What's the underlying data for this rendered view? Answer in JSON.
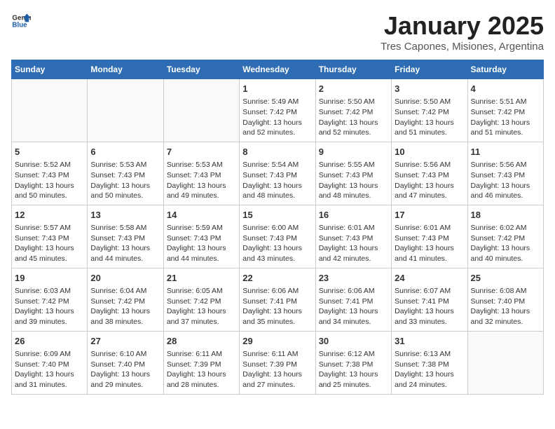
{
  "header": {
    "logo_general": "General",
    "logo_blue": "Blue",
    "title": "January 2025",
    "subtitle": "Tres Capones, Misiones, Argentina"
  },
  "weekdays": [
    "Sunday",
    "Monday",
    "Tuesday",
    "Wednesday",
    "Thursday",
    "Friday",
    "Saturday"
  ],
  "weeks": [
    [
      {
        "day": "",
        "info": ""
      },
      {
        "day": "",
        "info": ""
      },
      {
        "day": "",
        "info": ""
      },
      {
        "day": "1",
        "info": "Sunrise: 5:49 AM\nSunset: 7:42 PM\nDaylight: 13 hours\nand 52 minutes."
      },
      {
        "day": "2",
        "info": "Sunrise: 5:50 AM\nSunset: 7:42 PM\nDaylight: 13 hours\nand 52 minutes."
      },
      {
        "day": "3",
        "info": "Sunrise: 5:50 AM\nSunset: 7:42 PM\nDaylight: 13 hours\nand 51 minutes."
      },
      {
        "day": "4",
        "info": "Sunrise: 5:51 AM\nSunset: 7:42 PM\nDaylight: 13 hours\nand 51 minutes."
      }
    ],
    [
      {
        "day": "5",
        "info": "Sunrise: 5:52 AM\nSunset: 7:43 PM\nDaylight: 13 hours\nand 50 minutes."
      },
      {
        "day": "6",
        "info": "Sunrise: 5:53 AM\nSunset: 7:43 PM\nDaylight: 13 hours\nand 50 minutes."
      },
      {
        "day": "7",
        "info": "Sunrise: 5:53 AM\nSunset: 7:43 PM\nDaylight: 13 hours\nand 49 minutes."
      },
      {
        "day": "8",
        "info": "Sunrise: 5:54 AM\nSunset: 7:43 PM\nDaylight: 13 hours\nand 48 minutes."
      },
      {
        "day": "9",
        "info": "Sunrise: 5:55 AM\nSunset: 7:43 PM\nDaylight: 13 hours\nand 48 minutes."
      },
      {
        "day": "10",
        "info": "Sunrise: 5:56 AM\nSunset: 7:43 PM\nDaylight: 13 hours\nand 47 minutes."
      },
      {
        "day": "11",
        "info": "Sunrise: 5:56 AM\nSunset: 7:43 PM\nDaylight: 13 hours\nand 46 minutes."
      }
    ],
    [
      {
        "day": "12",
        "info": "Sunrise: 5:57 AM\nSunset: 7:43 PM\nDaylight: 13 hours\nand 45 minutes."
      },
      {
        "day": "13",
        "info": "Sunrise: 5:58 AM\nSunset: 7:43 PM\nDaylight: 13 hours\nand 44 minutes."
      },
      {
        "day": "14",
        "info": "Sunrise: 5:59 AM\nSunset: 7:43 PM\nDaylight: 13 hours\nand 44 minutes."
      },
      {
        "day": "15",
        "info": "Sunrise: 6:00 AM\nSunset: 7:43 PM\nDaylight: 13 hours\nand 43 minutes."
      },
      {
        "day": "16",
        "info": "Sunrise: 6:01 AM\nSunset: 7:43 PM\nDaylight: 13 hours\nand 42 minutes."
      },
      {
        "day": "17",
        "info": "Sunrise: 6:01 AM\nSunset: 7:43 PM\nDaylight: 13 hours\nand 41 minutes."
      },
      {
        "day": "18",
        "info": "Sunrise: 6:02 AM\nSunset: 7:42 PM\nDaylight: 13 hours\nand 40 minutes."
      }
    ],
    [
      {
        "day": "19",
        "info": "Sunrise: 6:03 AM\nSunset: 7:42 PM\nDaylight: 13 hours\nand 39 minutes."
      },
      {
        "day": "20",
        "info": "Sunrise: 6:04 AM\nSunset: 7:42 PM\nDaylight: 13 hours\nand 38 minutes."
      },
      {
        "day": "21",
        "info": "Sunrise: 6:05 AM\nSunset: 7:42 PM\nDaylight: 13 hours\nand 37 minutes."
      },
      {
        "day": "22",
        "info": "Sunrise: 6:06 AM\nSunset: 7:41 PM\nDaylight: 13 hours\nand 35 minutes."
      },
      {
        "day": "23",
        "info": "Sunrise: 6:06 AM\nSunset: 7:41 PM\nDaylight: 13 hours\nand 34 minutes."
      },
      {
        "day": "24",
        "info": "Sunrise: 6:07 AM\nSunset: 7:41 PM\nDaylight: 13 hours\nand 33 minutes."
      },
      {
        "day": "25",
        "info": "Sunrise: 6:08 AM\nSunset: 7:40 PM\nDaylight: 13 hours\nand 32 minutes."
      }
    ],
    [
      {
        "day": "26",
        "info": "Sunrise: 6:09 AM\nSunset: 7:40 PM\nDaylight: 13 hours\nand 31 minutes."
      },
      {
        "day": "27",
        "info": "Sunrise: 6:10 AM\nSunset: 7:40 PM\nDaylight: 13 hours\nand 29 minutes."
      },
      {
        "day": "28",
        "info": "Sunrise: 6:11 AM\nSunset: 7:39 PM\nDaylight: 13 hours\nand 28 minutes."
      },
      {
        "day": "29",
        "info": "Sunrise: 6:11 AM\nSunset: 7:39 PM\nDaylight: 13 hours\nand 27 minutes."
      },
      {
        "day": "30",
        "info": "Sunrise: 6:12 AM\nSunset: 7:38 PM\nDaylight: 13 hours\nand 25 minutes."
      },
      {
        "day": "31",
        "info": "Sunrise: 6:13 AM\nSunset: 7:38 PM\nDaylight: 13 hours\nand 24 minutes."
      },
      {
        "day": "",
        "info": ""
      }
    ]
  ]
}
